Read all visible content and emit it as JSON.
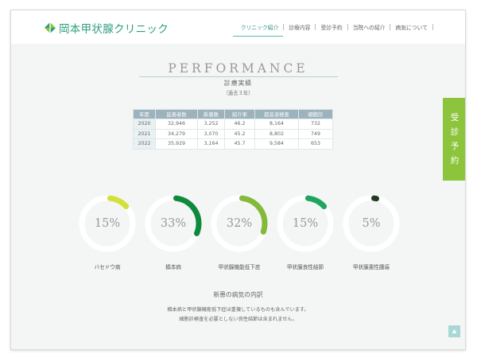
{
  "header": {
    "logo_text": "岡本甲状腺クリニック",
    "nav": [
      {
        "label": "クリニック紹介",
        "active": true
      },
      {
        "label": "診療内容",
        "active": false
      },
      {
        "label": "受診予約",
        "active": false
      },
      {
        "label": "当院への紹介",
        "active": false
      },
      {
        "label": "病気について",
        "active": false
      }
    ]
  },
  "side_tab": [
    "受",
    "診",
    "予",
    "約"
  ],
  "section": {
    "title_en": "PERFORMANCE",
    "title_ja": "診療実績",
    "subtitle": "（過去３年）"
  },
  "table": {
    "headers": [
      "年度",
      "延患者数",
      "新患数",
      "紹介率",
      "超音波検査",
      "細胞診"
    ],
    "rows": [
      [
        "2020",
        "32,946",
        "3,252",
        "46.2",
        "8,164",
        "732"
      ],
      [
        "2021",
        "34,279",
        "3,070",
        "45.2",
        "8,802",
        "749"
      ],
      [
        "2022",
        "35,929",
        "3,164",
        "45.7",
        "9,584",
        "653"
      ]
    ]
  },
  "donuts": [
    {
      "label": "バセドウ病",
      "pct_text": "15%",
      "value": 15,
      "color": "#d4e03a"
    },
    {
      "label": "橋本病",
      "pct_text": "33%",
      "value": 33,
      "color": "#0e8a3d"
    },
    {
      "label": "甲状腺機能低下症",
      "pct_text": "32%",
      "value": 32,
      "color": "#84b93a"
    },
    {
      "label": "甲状腺良性結節",
      "pct_text": "15%",
      "value": 15,
      "color": "#1ea661"
    },
    {
      "label": "甲状腺悪性腫瘍",
      "pct_text": "5%",
      "value": 5,
      "color": "#1f3a1e"
    }
  ],
  "note": {
    "title": "新患の病気の内訳",
    "line1": "橋本病と甲状腺機能低下症は重複しているものも含んでいます。",
    "line2": "細胞診検査を必要としない良性結節は含まれません。"
  },
  "colors": {
    "accent": "#2e9e7e",
    "side_tab": "#8cc43c",
    "table_header": "#9cb3bd",
    "scroll_top": "#a8d8d6"
  },
  "icons": {
    "logo": "logo-mark-icon",
    "scroll_top": "chevron-up-icon"
  }
}
